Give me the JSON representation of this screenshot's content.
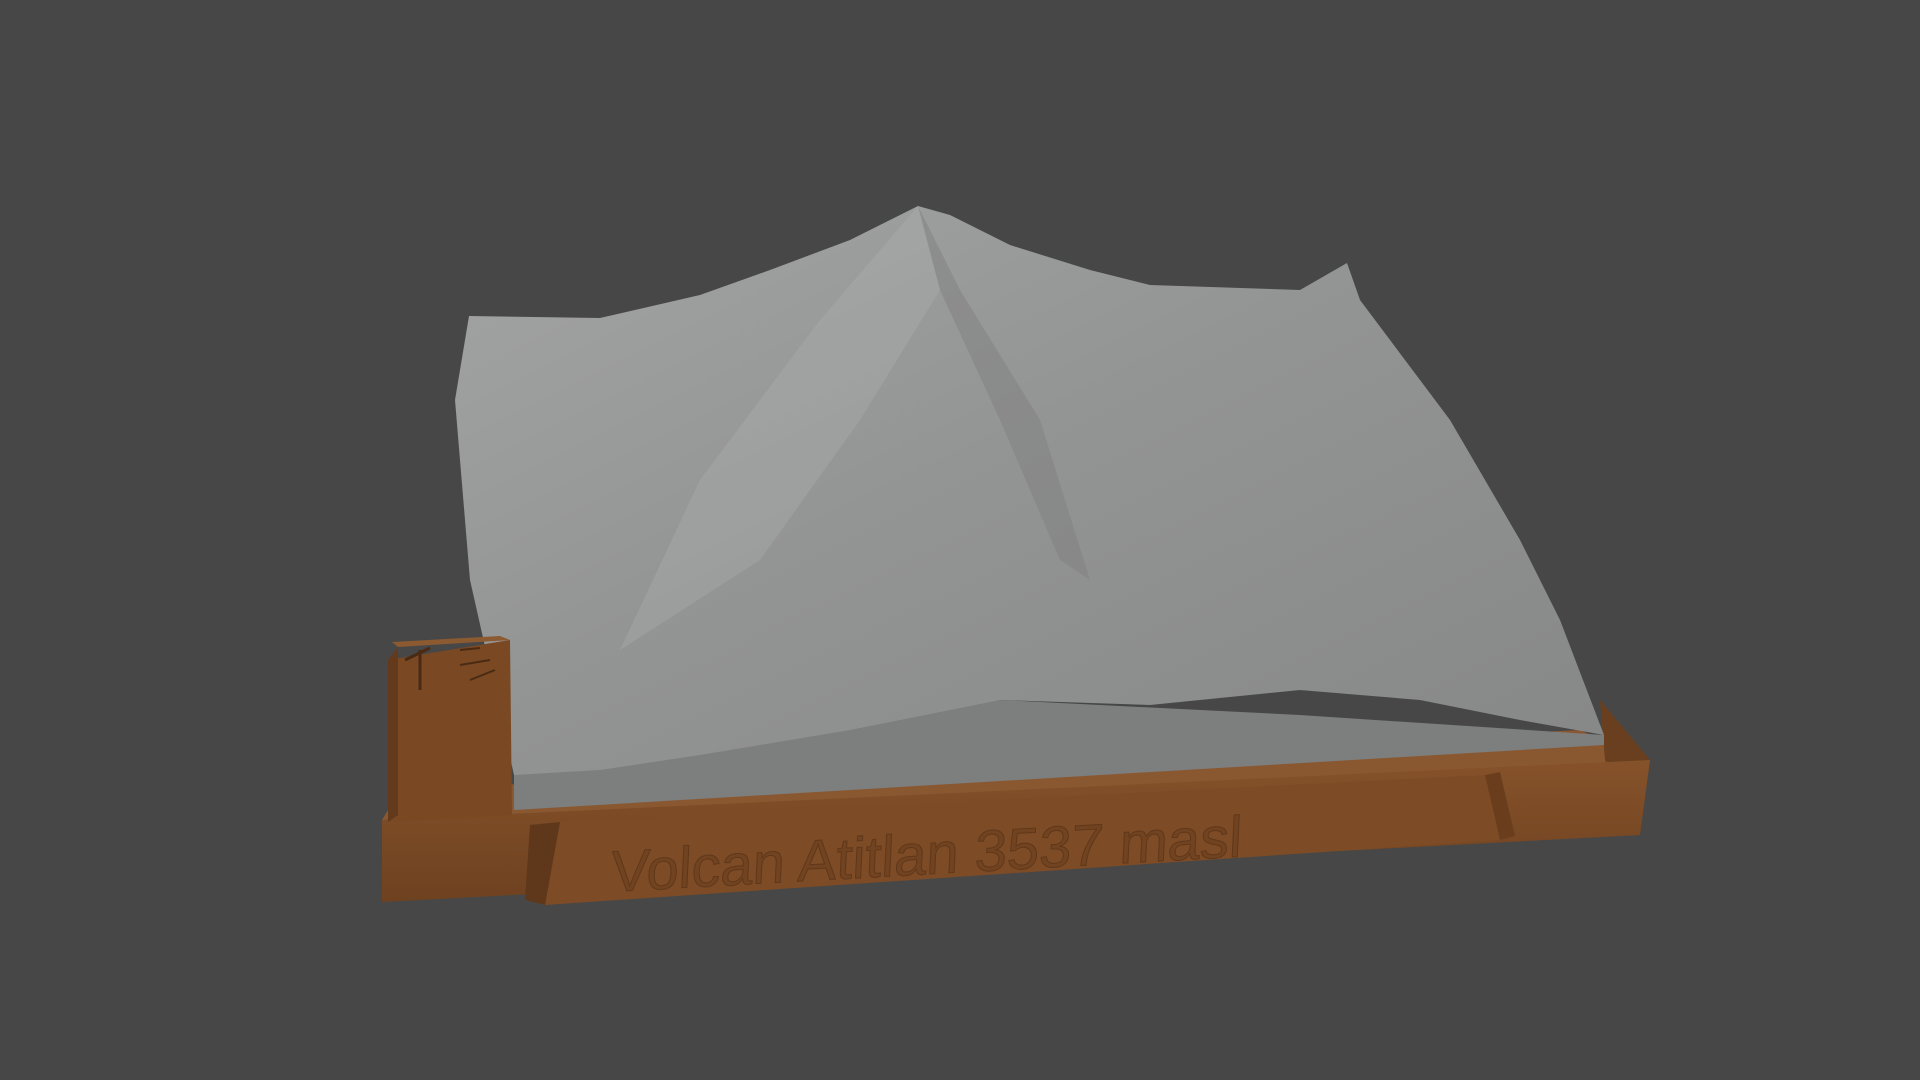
{
  "scene": {
    "label_text": "Volcan Atitlan 3537 masl",
    "colors": {
      "background": "#474747",
      "terrain": "#8f9090",
      "base": "#7a4a24"
    }
  }
}
